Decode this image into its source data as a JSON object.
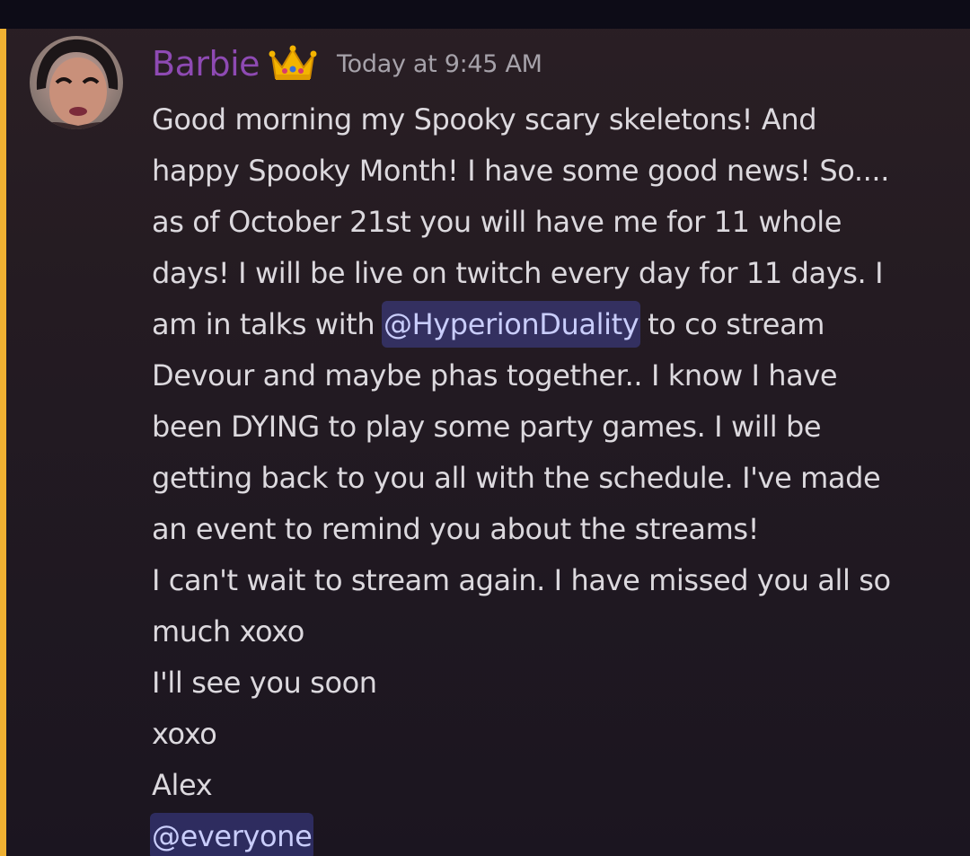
{
  "message": {
    "author": "Barbie",
    "author_badge_icon": "crown-emoji",
    "timestamp": "Today at 9:45 AM",
    "accent_colors": {
      "username": "#8e4ab3",
      "highlight_bar": "#f0b132",
      "mention_bg": "#3a3a6e",
      "mention_text": "#c9cdfb"
    },
    "lines": {
      "l1": "Good morning my Spooky scary skeletons! And",
      "l2": "happy Spooky Month! I have some good news! So....",
      "l3": "as of October 21st you will have me for 11 whole",
      "l4": "days! I will be live on twitch every day for 11 days. I",
      "l5_before": "am in talks with ",
      "l5_mention": "@HyperionDuality",
      "l5_after": " to co stream",
      "l6": "Devour and maybe phas together.. I know I have",
      "l7": "been DYING to play some party games. I will be",
      "l8": "getting back to you all with the schedule. I've made",
      "l9": "an event to remind you about the streams!",
      "l10": "I can't wait to stream again. I have missed you all so",
      "l11": "much xoxo",
      "l12": "I'll see you soon",
      "l13": "xoxo",
      "l14": "Alex",
      "l15_mention": "@everyone"
    }
  }
}
